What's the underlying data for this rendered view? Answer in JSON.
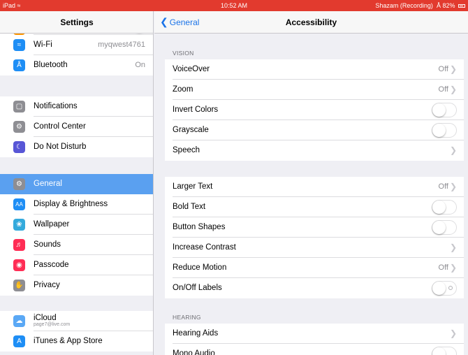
{
  "status_bar": {
    "device": "iPad",
    "time": "10:52 AM",
    "recording": "Shazam (Recording)",
    "battery": "82%"
  },
  "sidebar": {
    "title": "Settings",
    "items": [
      {
        "label": "Wi-Fi",
        "value": "myqwest4761",
        "icon": "wifi-icon",
        "color": "#1e8ef5"
      },
      {
        "label": "Bluetooth",
        "value": "On",
        "icon": "bluetooth-icon",
        "color": "#1e8ef5"
      },
      {
        "label": "Notifications",
        "icon": "notifications-icon",
        "color": "#8e8e93"
      },
      {
        "label": "Control Center",
        "icon": "control-center-icon",
        "color": "#8e8e93"
      },
      {
        "label": "Do Not Disturb",
        "icon": "moon-icon",
        "color": "#5856d6"
      },
      {
        "label": "General",
        "icon": "gear-icon",
        "color": "#8e8e93",
        "selected": true
      },
      {
        "label": "Display & Brightness",
        "icon": "display-icon",
        "color": "#1e8ef5"
      },
      {
        "label": "Wallpaper",
        "icon": "wallpaper-icon",
        "color": "#34aadc"
      },
      {
        "label": "Sounds",
        "icon": "speaker-icon",
        "color": "#ff2d55"
      },
      {
        "label": "Passcode",
        "icon": "lock-icon",
        "color": "#ff2d55"
      },
      {
        "label": "Privacy",
        "icon": "hand-icon",
        "color": "#8e8e93"
      },
      {
        "label": "iCloud",
        "sub": "page7@live.com",
        "icon": "cloud-icon",
        "color": "#5aa8f5"
      },
      {
        "label": "iTunes & App Store",
        "icon": "app-store-icon",
        "color": "#1e8ef5"
      }
    ]
  },
  "nav": {
    "back_label": "General",
    "title": "Accessibility"
  },
  "sections": {
    "vision_header": "VISION",
    "hearing_header": "HEARING"
  },
  "rows": {
    "voiceover": {
      "label": "VoiceOver",
      "value": "Off"
    },
    "zoom": {
      "label": "Zoom",
      "value": "Off"
    },
    "invert_colors": {
      "label": "Invert Colors",
      "on": false
    },
    "grayscale": {
      "label": "Grayscale",
      "on": false
    },
    "speech": {
      "label": "Speech"
    },
    "larger_text": {
      "label": "Larger Text",
      "value": "Off"
    },
    "bold_text": {
      "label": "Bold Text",
      "on": false
    },
    "button_shapes": {
      "label": "Button Shapes",
      "on": false
    },
    "increase_contrast": {
      "label": "Increase Contrast"
    },
    "reduce_motion": {
      "label": "Reduce Motion",
      "value": "Off"
    },
    "onoff_labels": {
      "label": "On/Off Labels",
      "on": false
    },
    "hearing_aids": {
      "label": "Hearing Aids"
    },
    "mono_audio": {
      "label": "Mono Audio",
      "on": false
    }
  },
  "colors": {
    "accent": "#1a73e8",
    "selected": "#5aa0f0",
    "status_bar": "#e23a2e"
  }
}
